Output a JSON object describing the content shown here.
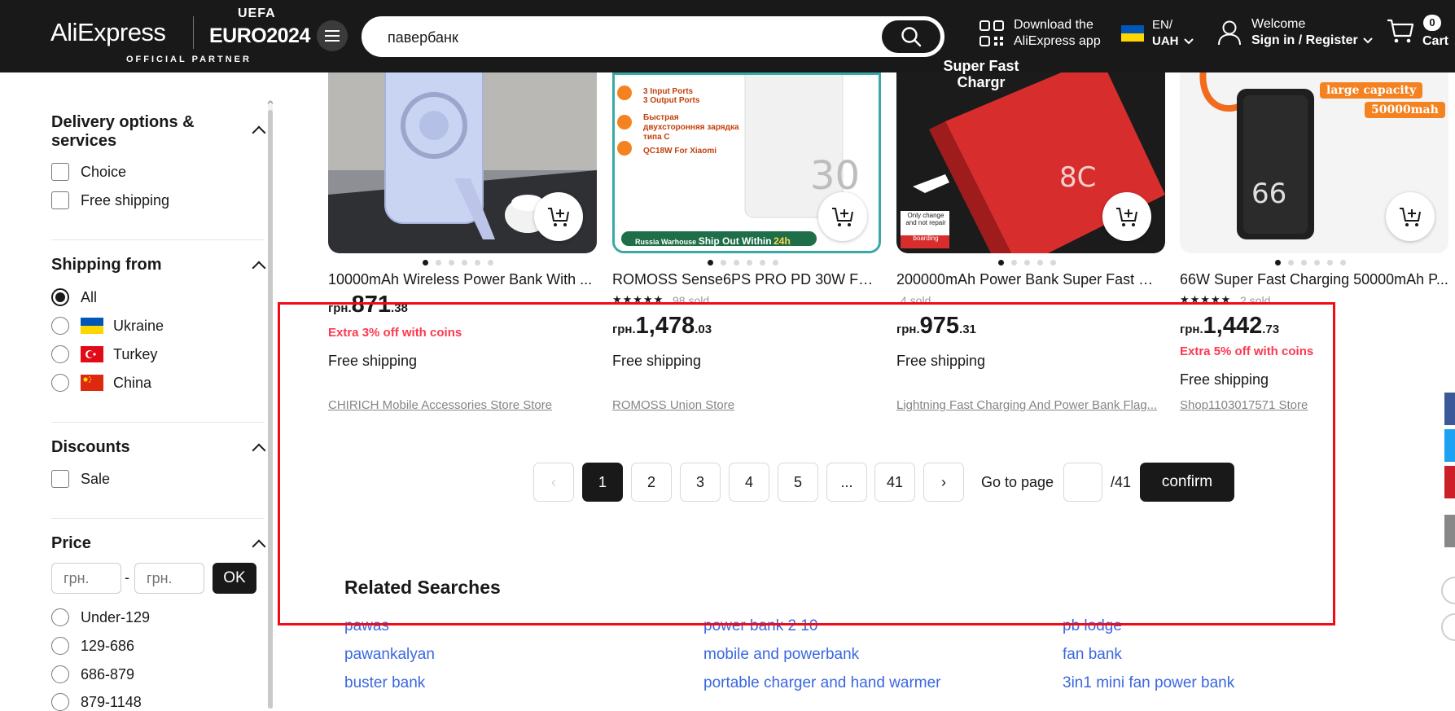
{
  "header": {
    "logo": "AliExpress",
    "euro_top": "UEFA",
    "euro": "EURO2024",
    "official_partner": "OFFICIAL PARTNER",
    "search_value": "павербанк",
    "app_line1": "Download the",
    "app_line2": "AliExpress app",
    "lang_line1": "EN/",
    "lang_line2": "UAH",
    "welcome": "Welcome",
    "signin": "Sign in / Register",
    "cart_count": "0",
    "cart_label": "Cart"
  },
  "sidebar": {
    "delivery": {
      "title_line1": "Delivery options &",
      "title_line2": "services",
      "options": [
        "Choice",
        "Free shipping"
      ]
    },
    "shipping_from": {
      "title": "Shipping from",
      "options": [
        "All",
        "Ukraine",
        "Turkey",
        "China"
      ],
      "selected": "All"
    },
    "discounts": {
      "title": "Discounts",
      "options": [
        "Sale"
      ]
    },
    "price": {
      "title": "Price",
      "min_placeholder": "грн.",
      "max_placeholder": "грн.",
      "dash": "-",
      "ok": "OK",
      "ranges": [
        "Under-129",
        "129-686",
        "686-879",
        "879-1148"
      ]
    }
  },
  "products": [
    {
      "title": "10000mAh Wireless Power Bank With ...",
      "currency": "грн.",
      "price_int": "871",
      "price_dec": ".38",
      "coins": "Extra 3% off with coins",
      "shipping": "Free shipping",
      "store": "CHIRICH Mobile Accessories Store Store"
    },
    {
      "title": "ROMOSS Sense6PS PRO PD 30W Fast ...",
      "sold": "98 sold",
      "currency": "грн.",
      "price_int": "1,478",
      "price_dec": ".03",
      "shipping": "Free shipping",
      "store": "ROMOSS Union Store",
      "img_text1": "3 Input Ports",
      "img_text2": "3 Output Ports",
      "img_text3": "Быстрая двухсторонняя зарядка типа С",
      "img_text4": "QC18W For Xiaomi",
      "img_banner": "Russia Warhouse",
      "img_banner2": "Ship Out Within",
      "img_banner3": "24h"
    },
    {
      "title": "200000mAh Power Bank Super Fast Ch...",
      "sold": "4 sold",
      "currency": "грн.",
      "price_int": "975",
      "price_dec": ".31",
      "shipping": "Free shipping",
      "store": "Lightning Fast Charging And Power Bank Flag...",
      "img_text1": "Super Fast",
      "img_text2": "Chargr",
      "img_note": "Only change and not repair",
      "img_note2": "Portable boarding"
    },
    {
      "title": "66W Super Fast Charging 50000mAh P...",
      "sold": "2 sold",
      "currency": "грн.",
      "price_int": "1,442",
      "price_dec": ".73",
      "coins": "Extra 5% off with coins",
      "shipping": "Free shipping",
      "store": "Shop1103017571 Store",
      "img_text1": "large capacity",
      "img_text2": "50000mah"
    }
  ],
  "pagination": {
    "prev": "‹",
    "pages": [
      "1",
      "2",
      "3",
      "4",
      "5",
      "...",
      "41"
    ],
    "current": "1",
    "next": "›",
    "goto_label": "Go to page",
    "total": "/41",
    "confirm": "confirm"
  },
  "related": {
    "title": "Related Searches",
    "col1": [
      "pawas",
      "pawankalyan",
      "buster bank"
    ],
    "col2": [
      "power bank 2 10",
      "mobile and powerbank",
      "portable charger and hand warmer"
    ],
    "col3": [
      "pb lodge",
      "fan bank",
      "3in1 mini fan power bank"
    ]
  },
  "colors": {
    "header_bg": "#191919",
    "accent_red": "#fd384f",
    "link_blue": "#3b67e0",
    "highlight": "#f00c17"
  }
}
